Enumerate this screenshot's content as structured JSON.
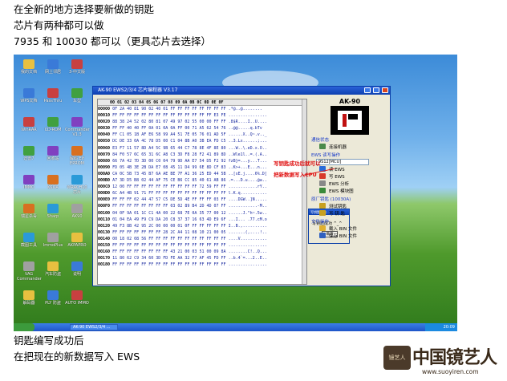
{
  "captions": {
    "line1": "在全新的地方选择要新做的钥匙",
    "line2": "芯片有两种都可以做",
    "line3": "7935 和 10030   都可以（更具芯片去选择）",
    "line4": "钥匙编写成功后",
    "line5": "在把现在的新数据写入 EWS"
  },
  "desktop": {
    "icons": [
      "我的文档",
      "WPS文档",
      "WinRAR",
      "迅雷7",
      "IMMO",
      "瑞星杀毒",
      "截图工具",
      "VAG Commander",
      "解码器",
      "网上邻居",
      "PassThru",
      "CD-ROM",
      "回收站",
      "KSOA",
      "Sharp",
      "ImmoPlus",
      "汽车防盗",
      "PLY 防盗",
      "3-中文版",
      "车型",
      "Commander V1.3",
      "解码 Elf EPROM",
      "WRACH10 芯片",
      "AK90",
      "AKPAPRO",
      "说明",
      "AUTO IMMO"
    ],
    "taskbar": {
      "start": "",
      "item": "AK-90 EWS2/3/4 ...",
      "clock": "20:09"
    }
  },
  "app": {
    "title": "AK-90 EWS2/3/4 芯片编程器 V3.17",
    "hex_header": "     00 01 02 03 04 05 06 07 08 09 0A 0B 0C 0D 0E 0F",
    "rows": [
      {
        "addr": "00000",
        "bytes": "0F 2A 40 81 90 02 40 01 FF FF FF FF FF FF FF FF",
        "ascii": ".*@..@........"
      },
      {
        "addr": "00010",
        "bytes": "FF FF FF FF FF FF FF FF FF FF FF FF FF FF E3 FE",
        "ascii": "................"
      },
      {
        "addr": "00020",
        "bytes": "88 38 24 52 02 80 81 07 49 97 02 55 00 00 FF FF",
        "ascii": ".8$R....I..U...."
      },
      {
        "addr": "00030",
        "bytes": "FF FF 40 40 FF 0A 01 0A 0A FF 00 71 A5 62 54 76",
        "ascii": "..@@.....q.bTv"
      },
      {
        "addr": "00040",
        "bytes": "FF C1 05 1B AF E6 58 99 A4 51 7E 05 76 01 AD 5F",
        "ascii": "......X..Q~.v.._"
      },
      {
        "addr": "00050",
        "bytes": "DC DE 33 0A 4C 78 D5 00 C1 04 8B A0 3B EA FD C5",
        "ascii": "..3.Lx......;..."
      },
      {
        "addr": "00060",
        "bytes": "E3 F7 11 57 8D A4 5C 9B 65 44 C7 78 8E 4F 8E 80",
        "ascii": "...W..\\.eD.x.O.."
      },
      {
        "addr": "00070",
        "bytes": "84 F0 57 6C 65 31 6C A8 C3 3D F8 28 F2 41 89 8D",
        "ascii": "..Wle1l..=.(.A.."
      },
      {
        "addr": "00080",
        "bytes": "66 7A 42 7D 3D 00 C0 04 79 9D AA E7 54 D5 F2 92",
        "ascii": "fzB}=...y...T..."
      },
      {
        "addr": "00090",
        "bytes": "FD 05 4B 3E 2B DA E7 08 45 11 D4 99 6E 8D CF 83",
        "ascii": "..K>+...E...n..."
      },
      {
        "addr": "000A0",
        "bytes": "CA 0C 5B 73 45 B7 6A AE BE 7F A1 36 25 ED 44 5B",
        "ascii": "..[sE.j....6%.D["
      },
      {
        "addr": "000B0",
        "bytes": "A7 3D D5 B8 02 44 AF 75 CE B6 CC 85 40 61 AB 86",
        "ascii": ".=...D.u....@a.."
      },
      {
        "addr": "000C0",
        "bytes": "12 00 FF FF FF FF FF FF FF FF FF FF 72 59 FF FF",
        "ascii": "............rY.."
      },
      {
        "addr": "000D0",
        "bytes": "6C A4 4B 91 71 FF FF FF FF FF FF FF FF FF FF FF",
        "ascii": "l.K.q..........."
      },
      {
        "addr": "000E0",
        "bytes": "FF FF FF 02 44 47 57 C5 DE 5D 4E FF FF FF 03 FF",
        "ascii": "....DGW..]N....."
      },
      {
        "addr": "000F0",
        "bytes": "FF FF FF FF FF FF FF FF 03 02 89 B4 2D 4D 07 FF",
        "ascii": "............-M.."
      },
      {
        "addr": "00100",
        "bytes": "04 0F 9A 01 1C C1 4A 00 22 68 7E 0A 35 77 00 12",
        "ascii": "......J.\"h~.5w.."
      },
      {
        "addr": "00110",
        "bytes": "01 04 EA 49 F9 C9 DA 20 C8 37 37 16 63 4D E9 6F",
        "ascii": "...I... .77.cM.o"
      },
      {
        "addr": "00120",
        "bytes": "49 F3 8B 42 95 2C 00 00 00 01 0F FF FF FF FF FF",
        "ascii": "I..B.,.........."
      },
      {
        "addr": "00130",
        "bytes": "FF FF FF FF FF FF FF 28 2C A4 11 08 10 21 00 05",
        "ascii": ".......(,....!.."
      },
      {
        "addr": "00140",
        "bytes": "00 18 02 08 56 FF FF FF FF FF FF FF FF FF FF FF",
        "ascii": "....V..........."
      },
      {
        "addr": "00150",
        "bytes": "FF FF FF FF FF FF FF FF FF FF FF FF FF FF FF FF",
        "ascii": "................"
      },
      {
        "addr": "00160",
        "bytes": "FF FF FF FF FF FF FF FF 43 21 00 03 51 00 09 8A",
        "ascii": "........C!..Q..."
      },
      {
        "addr": "00170",
        "bytes": "11 80 62 C9 34 60 3D FD FE AA 32 F7 AF 45 FD FF",
        "ascii": "..b.4`=...2..E.."
      },
      {
        "addr": "00180",
        "bytes": "FF FF FF FF FF FF FF FF FF FF FF FF FF FF FF FF",
        "ascii": "................"
      }
    ],
    "dialog": {
      "title": "写钥匙成功 ...",
      "message": "写钥匙成功 ^_^",
      "ok": "确定"
    },
    "panel": {
      "logo_title": "AK-90",
      "comm_label": "通信状态",
      "connect": "连接机器",
      "ews_label": "EWS 读写操作",
      "combo": "9S12[MCU]",
      "read_ews": "读 EWS",
      "write_ews": "写 EWS",
      "analyze_ews": "EWS 分析",
      "ews_module": "EWS 模块图",
      "orig_key_label": "原厂钥匙 (10030A)",
      "test_key": "测试钥匙",
      "write_key": "写 钥 匙",
      "file_label": "文件操作",
      "load_bin": "载入 BIN 文件",
      "save_bin": "保存 BIN 文件"
    },
    "annotations": {
      "red1": "写钥匙成功后就可以",
      "red2": "把新数据写入CPU"
    }
  },
  "watermark": {
    "seal": "镜艺人",
    "title": "中国镜艺人",
    "url": "www.suoyiren.com"
  },
  "colors": {
    "hex_text": "#1a2aa0",
    "annotation_red": "#e01010",
    "titlebar_blue": "#0c3fb0"
  }
}
